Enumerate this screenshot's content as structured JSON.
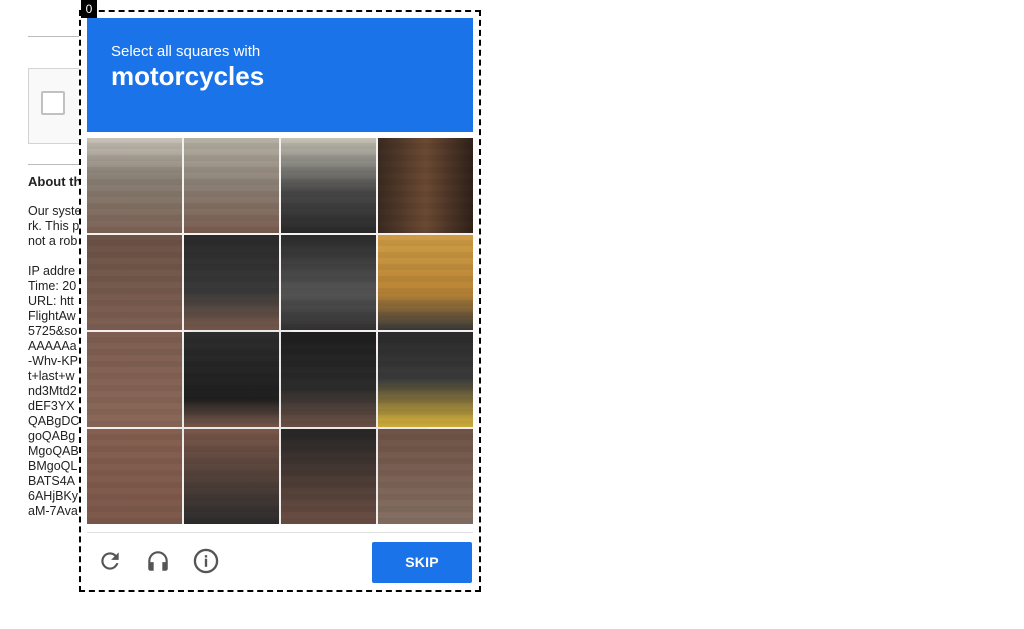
{
  "challenge": {
    "counter": "0",
    "instruction_small": "Select all squares with",
    "instruction_big": "motorcycles",
    "grid": {
      "rows": 4,
      "cols": 4,
      "tiles": [
        "r1c1",
        "r1c2",
        "r1c3",
        "r1c4",
        "r2c1",
        "r2c2",
        "r2c3",
        "r2c4",
        "r3c1",
        "r3c2",
        "r3c3",
        "r3c4",
        "r4c1",
        "r4c2",
        "r4c3",
        "r4c4"
      ]
    },
    "footer": {
      "reload_icon": "reload-icon",
      "audio_icon": "headphones-icon",
      "info_icon": "info-icon",
      "skip_label": "SKIP"
    }
  },
  "background_page": {
    "about_title": "About th",
    "info_lines": [
      "Our syste",
      "rk. This p",
      "not a rob",
      "",
      "IP addre",
      "Time: 20",
      "URL: htt",
      "FlightAw",
      "5725&so",
      "AAAAAa",
      "-Whv-KP",
      "t+last+w",
      "nd3Mtd2",
      "dEF3YX",
      "QABgDC",
      "goQABg",
      "MgoQAB",
      "BMgoQL",
      "BATS4A",
      "6AHjBKy",
      "aM-7Ava"
    ]
  },
  "colors": {
    "accent": "#1a73e8",
    "text": "#222222"
  }
}
